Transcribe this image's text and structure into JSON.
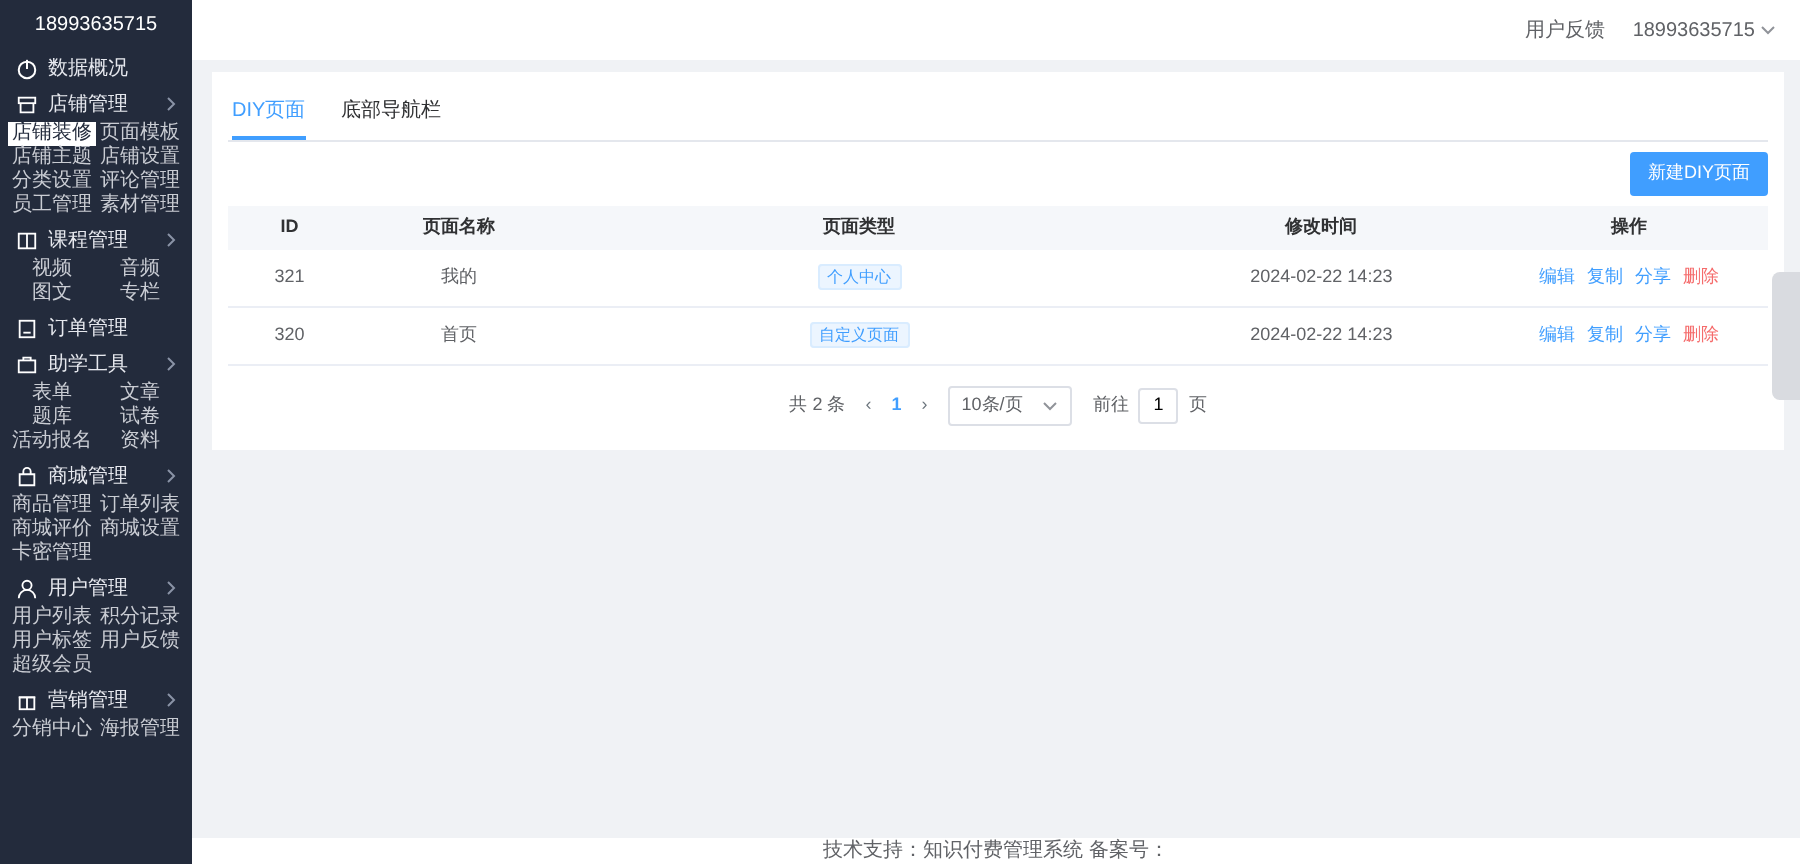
{
  "sidebar": {
    "account": "18993635715",
    "groups": [
      {
        "label": "数据概况",
        "expandable": false
      },
      {
        "label": "店铺管理",
        "expandable": true,
        "items": [
          {
            "label": "店铺装修",
            "selected": true
          },
          {
            "label": "页面模板",
            "selected": false
          },
          {
            "label": "店铺主题",
            "selected": false
          },
          {
            "label": "店铺设置",
            "selected": false
          },
          {
            "label": "分类设置",
            "selected": false
          },
          {
            "label": "评论管理",
            "selected": false
          },
          {
            "label": "员工管理",
            "selected": false
          },
          {
            "label": "素材管理",
            "selected": false
          }
        ]
      },
      {
        "label": "课程管理",
        "expandable": true,
        "items": [
          {
            "label": "视频",
            "selected": false
          },
          {
            "label": "音频",
            "selected": false
          },
          {
            "label": "图文",
            "selected": false
          },
          {
            "label": "专栏",
            "selected": false
          }
        ]
      },
      {
        "label": "订单管理",
        "expandable": false
      },
      {
        "label": "助学工具",
        "expandable": true,
        "items": [
          {
            "label": "表单",
            "selected": false
          },
          {
            "label": "文章",
            "selected": false
          },
          {
            "label": "题库",
            "selected": false
          },
          {
            "label": "试卷",
            "selected": false
          },
          {
            "label": "活动报名",
            "selected": false
          },
          {
            "label": "资料",
            "selected": false
          }
        ]
      },
      {
        "label": "商城管理",
        "expandable": true,
        "items": [
          {
            "label": "商品管理",
            "selected": false
          },
          {
            "label": "订单列表",
            "selected": false
          },
          {
            "label": "商城评价",
            "selected": false
          },
          {
            "label": "商城设置",
            "selected": false
          },
          {
            "label": "卡密管理",
            "selected": false
          }
        ]
      },
      {
        "label": "用户管理",
        "expandable": true,
        "items": [
          {
            "label": "用户列表",
            "selected": false
          },
          {
            "label": "积分记录",
            "selected": false
          },
          {
            "label": "用户标签",
            "selected": false
          },
          {
            "label": "用户反馈",
            "selected": false
          },
          {
            "label": "超级会员",
            "selected": false
          }
        ]
      },
      {
        "label": "营销管理",
        "expandable": true,
        "items": [
          {
            "label": "分销中心",
            "selected": false
          },
          {
            "label": "海报管理",
            "selected": false
          }
        ]
      }
    ]
  },
  "header": {
    "feedback": "用户反馈",
    "account": "18993635715"
  },
  "tabs": [
    {
      "label": "DIY页面",
      "selected": true
    },
    {
      "label": "底部导航栏",
      "selected": false
    }
  ],
  "new_button": "新建DIY页面",
  "table": {
    "columns": [
      "ID",
      "页面名称",
      "页面类型",
      "修改时间",
      "操作"
    ],
    "rows": [
      {
        "id": "321",
        "name": "我的",
        "type": "个人中心",
        "time": "2024-02-22 14:23",
        "actions": [
          {
            "label": "编辑",
            "kind": "normal"
          },
          {
            "label": "复制",
            "kind": "normal"
          },
          {
            "label": "分享",
            "kind": "normal"
          },
          {
            "label": "删除",
            "kind": "danger"
          }
        ]
      },
      {
        "id": "320",
        "name": "首页",
        "type": "自定义页面",
        "time": "2024-02-22 14:23",
        "actions": [
          {
            "label": "编辑",
            "kind": "normal"
          },
          {
            "label": "复制",
            "kind": "normal"
          },
          {
            "label": "分享",
            "kind": "normal"
          },
          {
            "label": "删除",
            "kind": "danger"
          }
        ]
      }
    ]
  },
  "pagination": {
    "total": "共 2 条",
    "prev": "‹",
    "pages": [
      {
        "label": "1",
        "selected": true
      }
    ],
    "next": "›",
    "page_size": "10条/页",
    "goto_label": "前往",
    "goto_value": "1",
    "goto_suffix": "页"
  },
  "footer": "技术支持：知识付费管理系统 备案号："
}
